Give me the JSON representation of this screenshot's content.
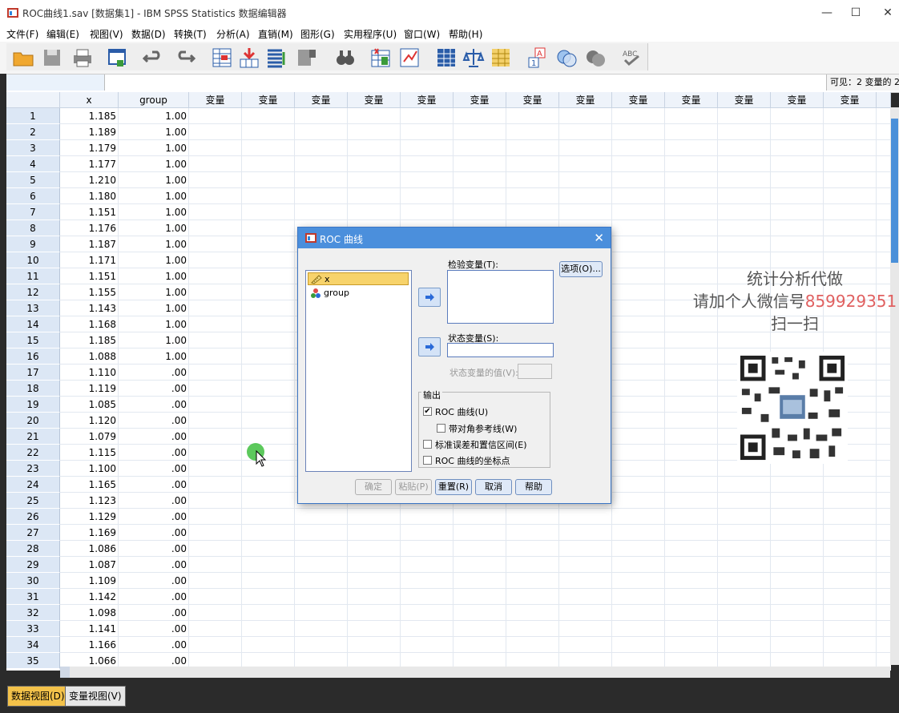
{
  "window": {
    "title": "ROC曲线1.sav [数据集1] - IBM SPSS Statistics 数据编辑器",
    "minimize": "—",
    "maximize": "☐",
    "close": "✕"
  },
  "menu": [
    "文件(F)",
    "编辑(E)",
    "视图(V)",
    "数据(D)",
    "转换(T)",
    "分析(A)",
    "直销(M)",
    "图形(G)",
    "实用程序(U)",
    "窗口(W)",
    "帮助(H)"
  ],
  "toolbar_icons": [
    "open-icon",
    "save-icon",
    "print-icon",
    "dialog-recall-icon",
    "undo-icon",
    "redo-icon",
    "goto-case-icon",
    "goto-variable-icon",
    "variables-icon",
    "run-descriptive-icon",
    "find-icon",
    "insert-cases-icon",
    "insert-variable-icon",
    "split-file-icon",
    "weight-cases-icon",
    "select-cases-icon",
    "value-labels-icon",
    "use-sets-icon",
    "show-all-icon",
    "spell-check-icon"
  ],
  "editbar": {
    "visible_text": "可见：2 变量的 2"
  },
  "grid": {
    "columns": [
      "x",
      "group",
      "变量",
      "变量",
      "变量",
      "变量",
      "变量",
      "变量",
      "变量",
      "变量",
      "变量",
      "变量",
      "变量",
      "变量",
      "变量"
    ],
    "rows": [
      [
        "1",
        "1.185",
        "1.00"
      ],
      [
        "2",
        "1.189",
        "1.00"
      ],
      [
        "3",
        "1.179",
        "1.00"
      ],
      [
        "4",
        "1.177",
        "1.00"
      ],
      [
        "5",
        "1.210",
        "1.00"
      ],
      [
        "6",
        "1.180",
        "1.00"
      ],
      [
        "7",
        "1.151",
        "1.00"
      ],
      [
        "8",
        "1.176",
        "1.00"
      ],
      [
        "9",
        "1.187",
        "1.00"
      ],
      [
        "10",
        "1.171",
        "1.00"
      ],
      [
        "11",
        "1.151",
        "1.00"
      ],
      [
        "12",
        "1.155",
        "1.00"
      ],
      [
        "13",
        "1.143",
        "1.00"
      ],
      [
        "14",
        "1.168",
        "1.00"
      ],
      [
        "15",
        "1.185",
        "1.00"
      ],
      [
        "16",
        "1.088",
        "1.00"
      ],
      [
        "17",
        "1.110",
        ".00"
      ],
      [
        "18",
        "1.119",
        ".00"
      ],
      [
        "19",
        "1.085",
        ".00"
      ],
      [
        "20",
        "1.120",
        ".00"
      ],
      [
        "21",
        "1.079",
        ".00"
      ],
      [
        "22",
        "1.115",
        ".00"
      ],
      [
        "23",
        "1.100",
        ".00"
      ],
      [
        "24",
        "1.165",
        ".00"
      ],
      [
        "25",
        "1.123",
        ".00"
      ],
      [
        "26",
        "1.129",
        ".00"
      ],
      [
        "27",
        "1.169",
        ".00"
      ],
      [
        "28",
        "1.086",
        ".00"
      ],
      [
        "29",
        "1.087",
        ".00"
      ],
      [
        "30",
        "1.109",
        ".00"
      ],
      [
        "31",
        "1.142",
        ".00"
      ],
      [
        "32",
        "1.098",
        ".00"
      ],
      [
        "33",
        "1.141",
        ".00"
      ],
      [
        "34",
        "1.166",
        ".00"
      ],
      [
        "35",
        "1.066",
        ".00"
      ]
    ]
  },
  "tabs": {
    "data_view": "数据视图(D)",
    "variable_view": "变量视图(V)"
  },
  "dialog": {
    "title": "ROC 曲线",
    "close": "✕",
    "variables": [
      "x",
      "group"
    ],
    "test_var_label": "检验变量(T):",
    "state_var_label": "状态变量(S):",
    "state_value_label": "状态变量的值(V):",
    "options_button": "选项(O)...",
    "output_group": "输出",
    "roc_curve": "ROC 曲线(U)",
    "diag_ref": "带对角参考线(W)",
    "std_err": "标准误差和置信区间(E)",
    "coords": "ROC 曲线的坐标点",
    "ok": "确定",
    "paste": "粘贴(P)",
    "reset": "重置(R)",
    "cancel": "取消",
    "help": "帮助",
    "check_mark": "✔"
  },
  "watermark": {
    "line1": "统计分析代做",
    "line2_prefix": "请加个人微信号",
    "line2_number": "859929351",
    "line3": "扫一扫"
  },
  "colors": {
    "accent": "#4b8fdc",
    "selected_item": "#f7d36b",
    "grid_header": "#dce7f5"
  }
}
